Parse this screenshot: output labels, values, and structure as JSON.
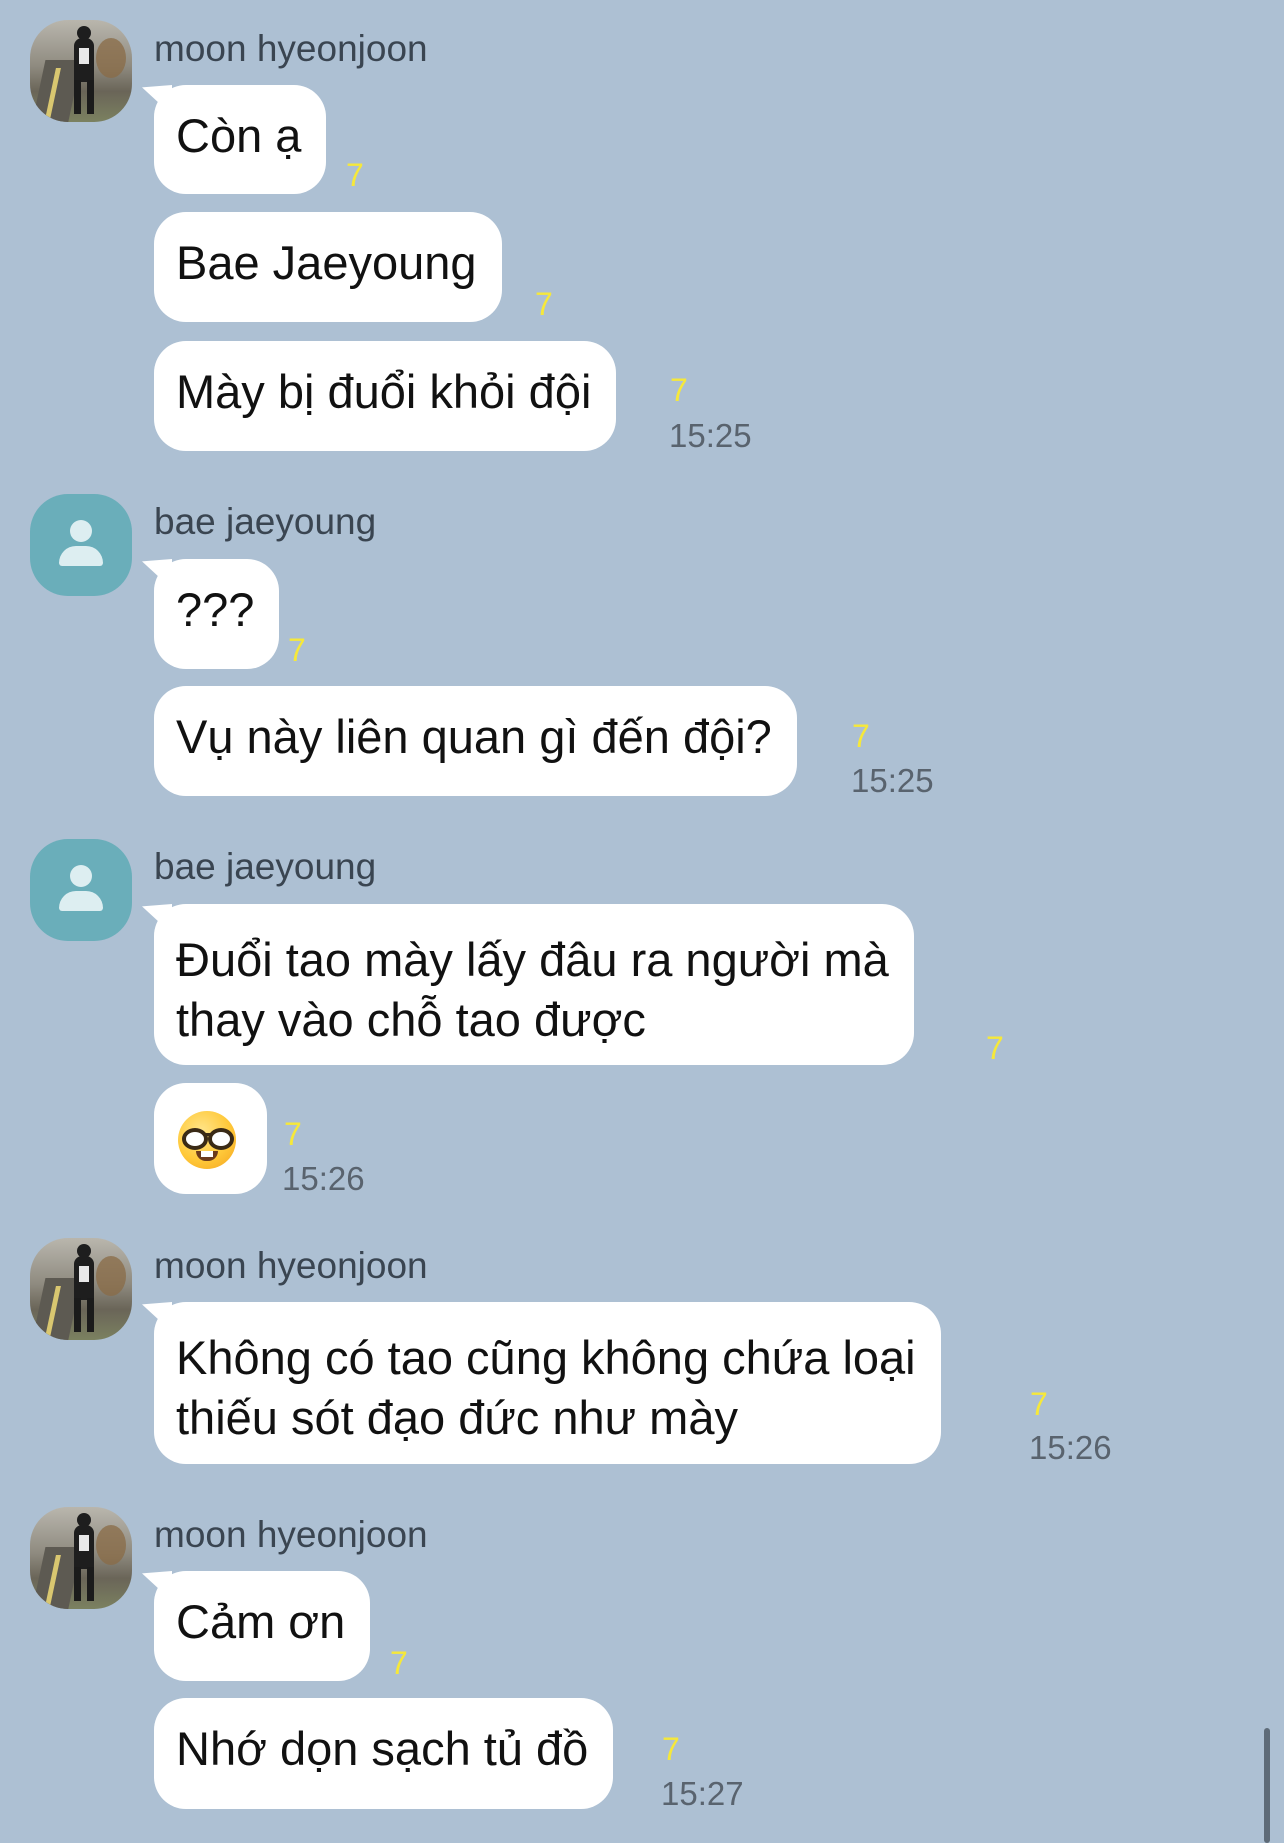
{
  "senders": {
    "moon": "moon hyeonjoon",
    "bae": "bae jaeyoung"
  },
  "groups": [
    {
      "sender": "moon hyeonjoon",
      "avatar": "profile-photo",
      "messages": [
        {
          "text": "Còn ạ",
          "unread": "7"
        },
        {
          "text": "Bae Jaeyoung",
          "unread": "7"
        },
        {
          "text": "Mày bị đuổi khỏi đội",
          "unread": "7",
          "time": "15:25"
        }
      ]
    },
    {
      "sender": "bae jaeyoung",
      "avatar": "default-person-icon",
      "messages": [
        {
          "text": "???",
          "unread": "7"
        },
        {
          "text": "Vụ này liên quan gì đến đội?",
          "unread": "7",
          "time": "15:25"
        }
      ]
    },
    {
      "sender": "bae jaeyoung",
      "avatar": "default-person-icon",
      "messages": [
        {
          "lines": [
            "Đuổi tao mày lấy đâu ra người mà",
            "thay vào chỗ tao được"
          ],
          "unread": "7"
        },
        {
          "emoji": "nerd-face-emoji",
          "unread": "7",
          "time": "15:26"
        }
      ]
    },
    {
      "sender": "moon hyeonjoon",
      "avatar": "profile-photo",
      "messages": [
        {
          "lines": [
            "Không có tao cũng không chứa loại",
            "thiếu sót đạo đức như mày"
          ],
          "unread": "7",
          "time": "15:26"
        }
      ]
    },
    {
      "sender": "moon hyeonjoon",
      "avatar": "profile-photo",
      "messages": [
        {
          "text": "Cảm ơn",
          "unread": "7"
        },
        {
          "text": "Nhớ dọn sạch tủ đồ",
          "unread": "7",
          "time": "15:27"
        }
      ]
    }
  ],
  "colors": {
    "background": "#adc0d3",
    "bubble": "#ffffff",
    "unread": "#f6e83a",
    "default_avatar": "#6aaeba"
  }
}
